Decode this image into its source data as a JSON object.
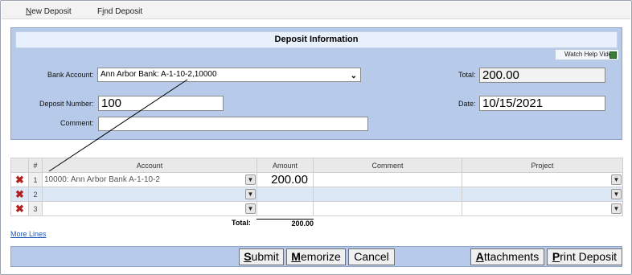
{
  "menu": {
    "new_deposit_u": "N",
    "new_deposit_rest": "ew Deposit",
    "find_deposit_pre": "F",
    "find_deposit_u": "i",
    "find_deposit_rest": "nd Deposit"
  },
  "panel": {
    "title": "Deposit Information",
    "help_link": "Watch Help Video!",
    "bank_account_label": "Bank Account:",
    "bank_account_value": "Ann Arbor Bank: A-1-10-2,10000",
    "deposit_number_label": "Deposit Number:",
    "deposit_number_value": "100",
    "comment_label": "Comment:",
    "comment_value": "",
    "total_label": "Total:",
    "total_value": "200.00",
    "date_label": "Date:",
    "date_value": "10/15/2021"
  },
  "grid": {
    "headers": [
      "#",
      "Account",
      "Amount",
      "Comment",
      "Project"
    ],
    "rows": [
      {
        "num": "1",
        "account": "10000: Ann Arbor Bank A-1-10-2",
        "amount": "200.00",
        "comment": "",
        "project": ""
      },
      {
        "num": "2",
        "account": "",
        "amount": "",
        "comment": "",
        "project": ""
      },
      {
        "num": "3",
        "account": "",
        "amount": "",
        "comment": "",
        "project": ""
      }
    ],
    "total_label": "Total:",
    "total_value": "200.00",
    "more_lines": "More Lines"
  },
  "buttons": {
    "submit_u": "S",
    "submit_rest": "ubmit",
    "memorize_u": "M",
    "memorize_rest": "emorize",
    "cancel": "Cancel",
    "attachments_u": "A",
    "attachments_rest": "ttachments",
    "print_u": "P",
    "print_rest": "rint Deposit"
  },
  "icons": {
    "delete": "red-x-icon",
    "dropdown": "chevron-down-icon",
    "help": "film-icon"
  }
}
